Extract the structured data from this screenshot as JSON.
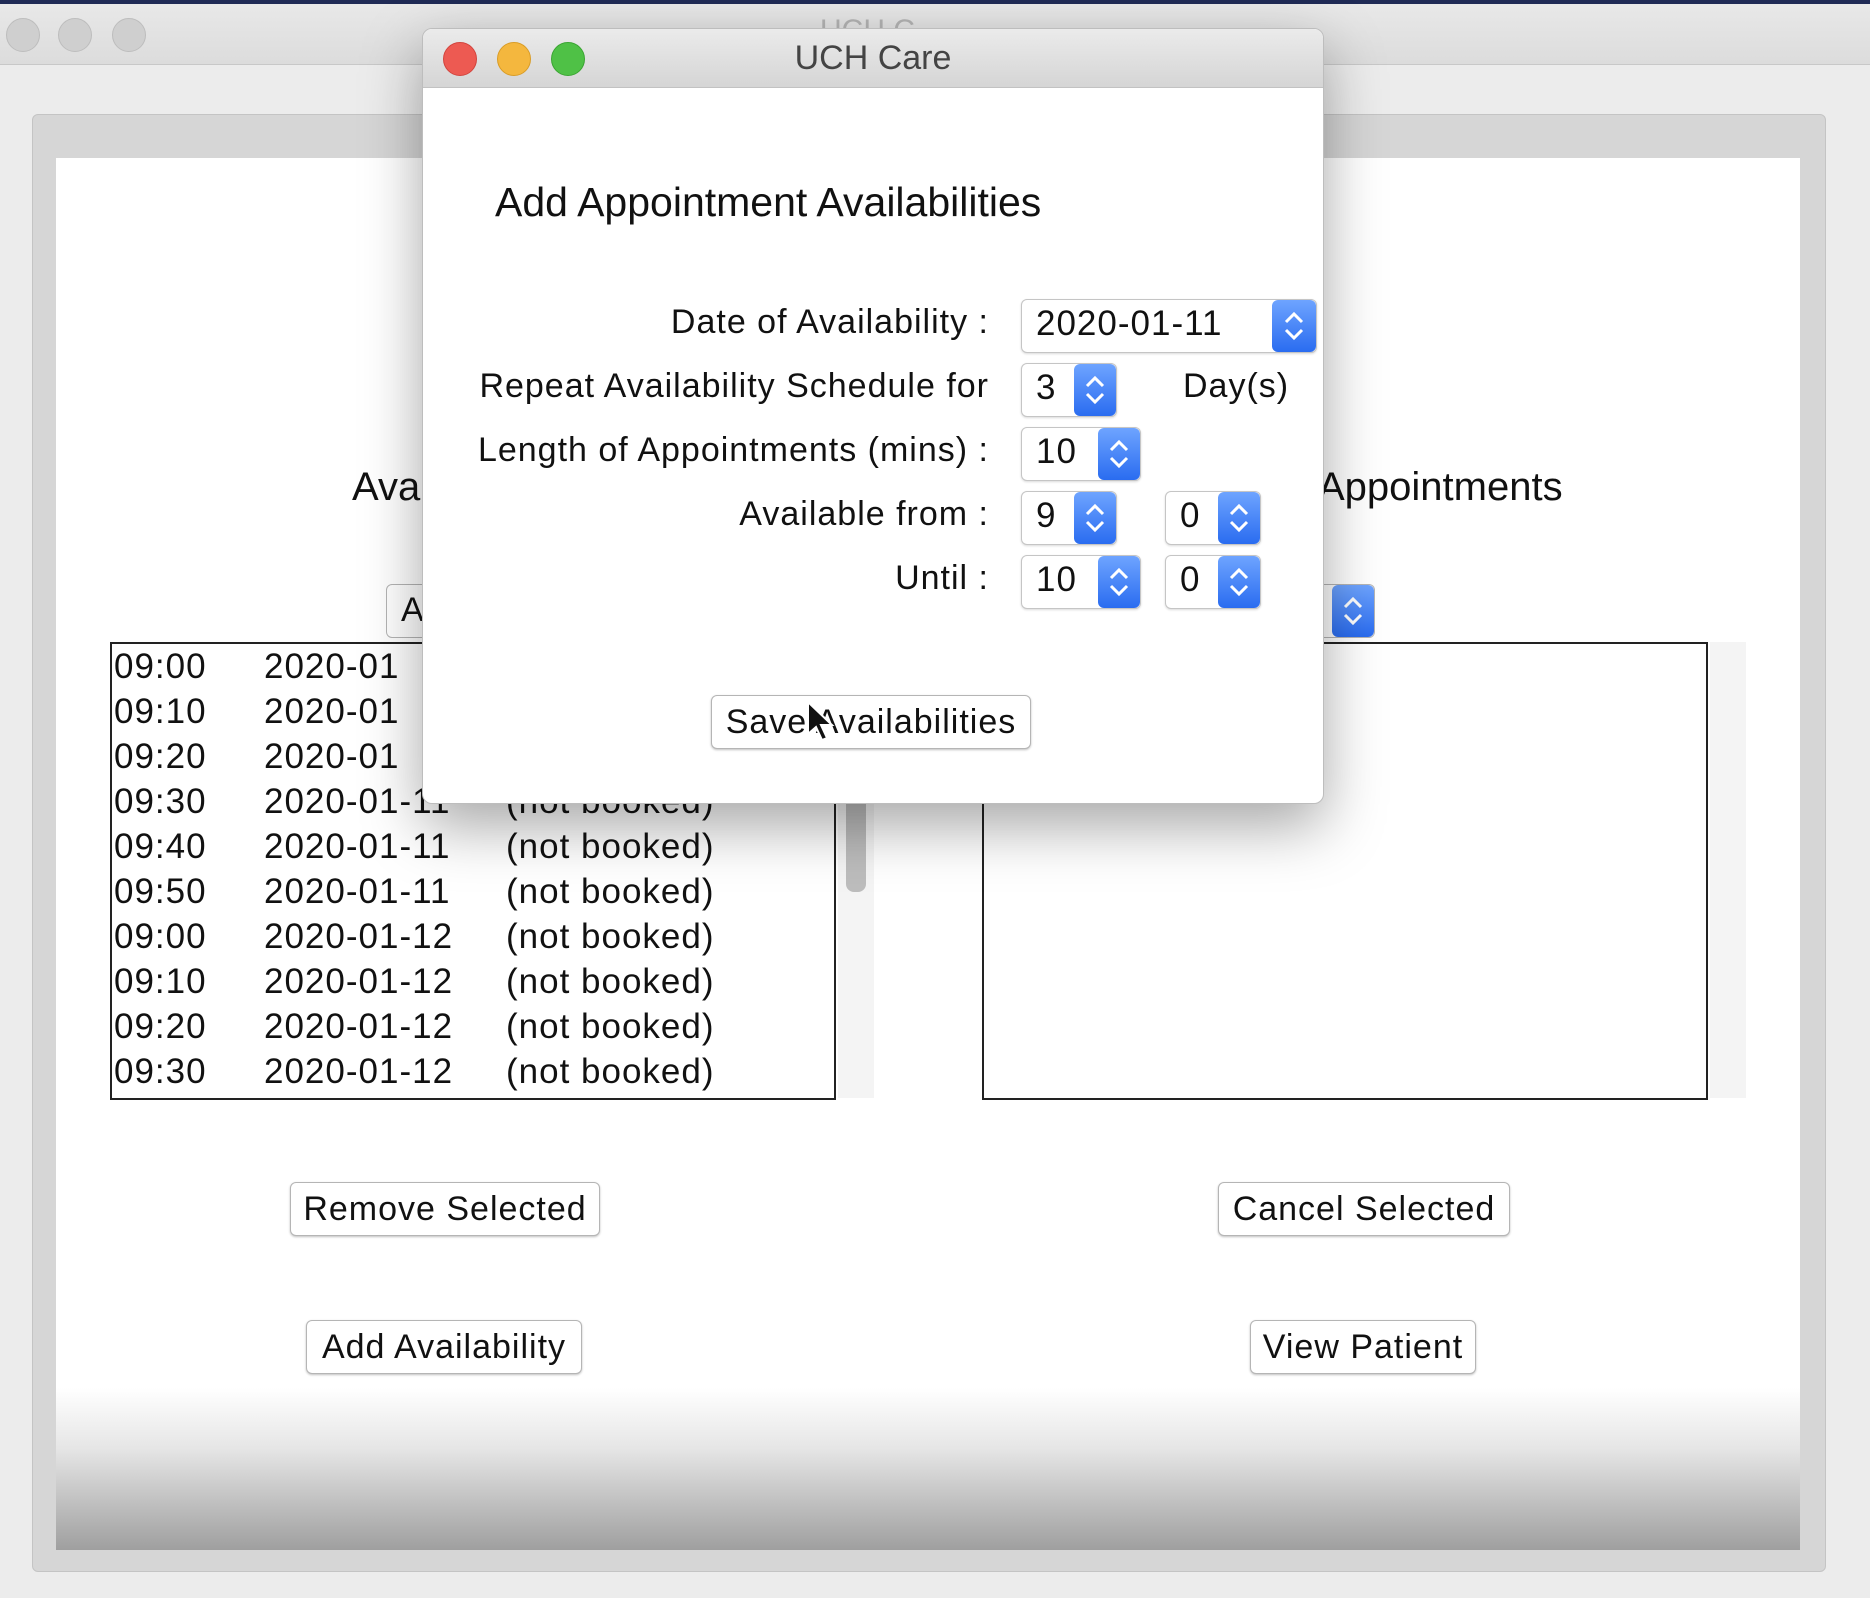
{
  "main_window": {
    "title": "UCH C",
    "left_section": {
      "title_partial": "Ava",
      "dropdown_partial": "A",
      "list": [
        {
          "time": "09:00",
          "date": "2020-01",
          "status": ""
        },
        {
          "time": "09:10",
          "date": "2020-01",
          "status": ""
        },
        {
          "time": "09:20",
          "date": "2020-01",
          "status": ""
        },
        {
          "time": "09:30",
          "date": "2020-01-11",
          "status": "(not booked)"
        },
        {
          "time": "09:40",
          "date": "2020-01-11",
          "status": "(not booked)"
        },
        {
          "time": "09:50",
          "date": "2020-01-11",
          "status": "(not booked)"
        },
        {
          "time": "09:00",
          "date": "2020-01-12",
          "status": "(not booked)"
        },
        {
          "time": "09:10",
          "date": "2020-01-12",
          "status": "(not booked)"
        },
        {
          "time": "09:20",
          "date": "2020-01-12",
          "status": "(not booked)"
        },
        {
          "time": "09:30",
          "date": "2020-01-12",
          "status": "(not booked)"
        }
      ],
      "remove_button": "Remove Selected",
      "add_button": "Add Availability"
    },
    "right_section": {
      "title_partial": "Appointments",
      "cancel_button": "Cancel Selected",
      "view_button": "View Patient"
    }
  },
  "dialog": {
    "title": "UCH Care",
    "heading": "Add Appointment Availabilities",
    "date_label": "Date of Availability :",
    "date_value": "2020-01-11",
    "repeat_label": "Repeat Availability Schedule for",
    "repeat_value": "3",
    "repeat_suffix": "Day(s)",
    "length_label": "Length of Appointments (mins) :",
    "length_value": "10",
    "from_label": "Available from :",
    "from_hour": "9",
    "from_minute": "0",
    "until_label": "Until :",
    "until_hour": "10",
    "until_minute": "0",
    "save_button": "Save Availabilities"
  },
  "colors": {
    "close": "#ed5a52",
    "minimize": "#f4b73e",
    "maximize": "#4fc146",
    "stepper_blue": "#2a6cf0"
  }
}
